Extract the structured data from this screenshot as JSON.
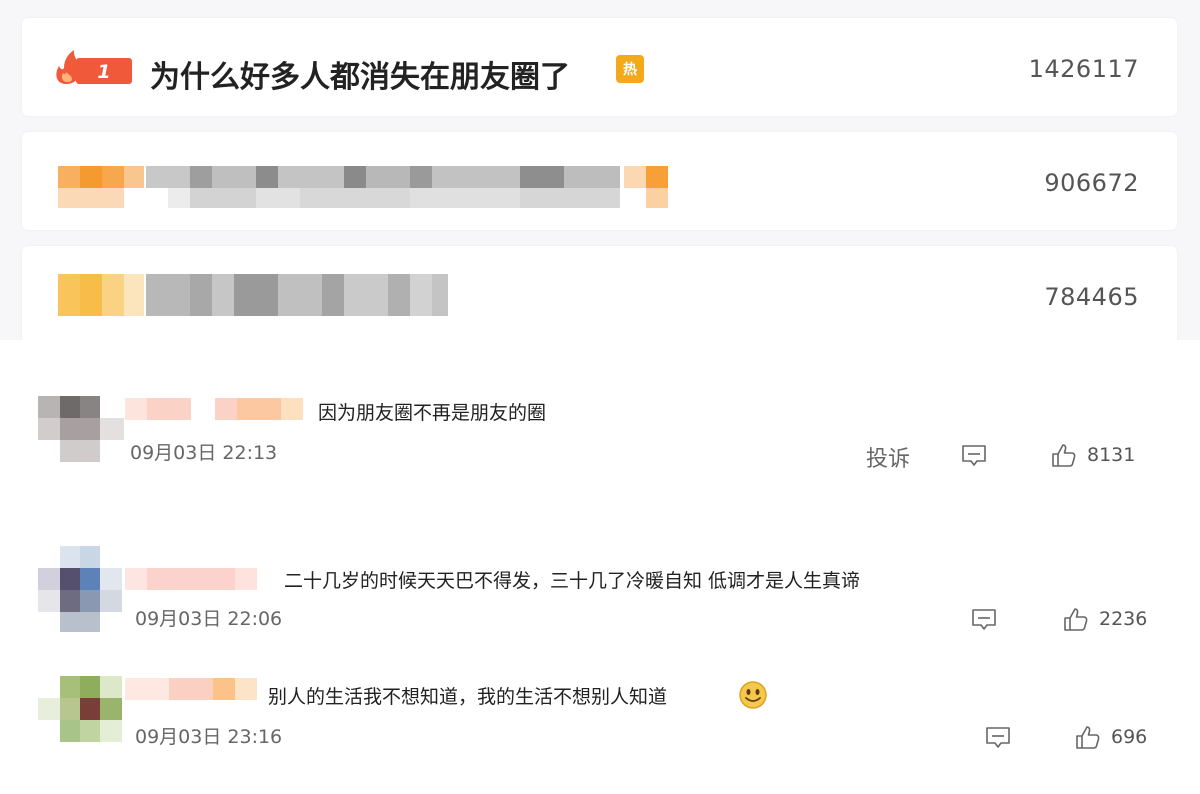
{
  "ranking": [
    {
      "rank": "1",
      "title": "为什么好多人都消失在朋友圈了",
      "tag": "热",
      "count": "1426117"
    },
    {
      "count": "906672"
    },
    {
      "count": "784465"
    }
  ],
  "comments": [
    {
      "text": "因为朋友圈不再是朋友的圈",
      "date": "09月03日 22:13",
      "report": "投诉",
      "likes": "8131"
    },
    {
      "text": "二十几岁的时候天天巴不得发，三十几了冷暖自知 低调才是人生真谛",
      "date": "09月03日 22:06",
      "likes": "2236"
    },
    {
      "text": "别人的生活我不想知道，我的生活不想别人知道",
      "date": "09月03日 23:16",
      "likes": "696"
    }
  ],
  "icons": {
    "hot": "fire-icon",
    "tag": "hot-tag-icon",
    "comment": "comment-icon",
    "like": "thumbs-up-icon",
    "emoji": "smiley-emoji-icon"
  },
  "colors": {
    "accent": "#f05a3a",
    "tag": "#f3a91a"
  }
}
